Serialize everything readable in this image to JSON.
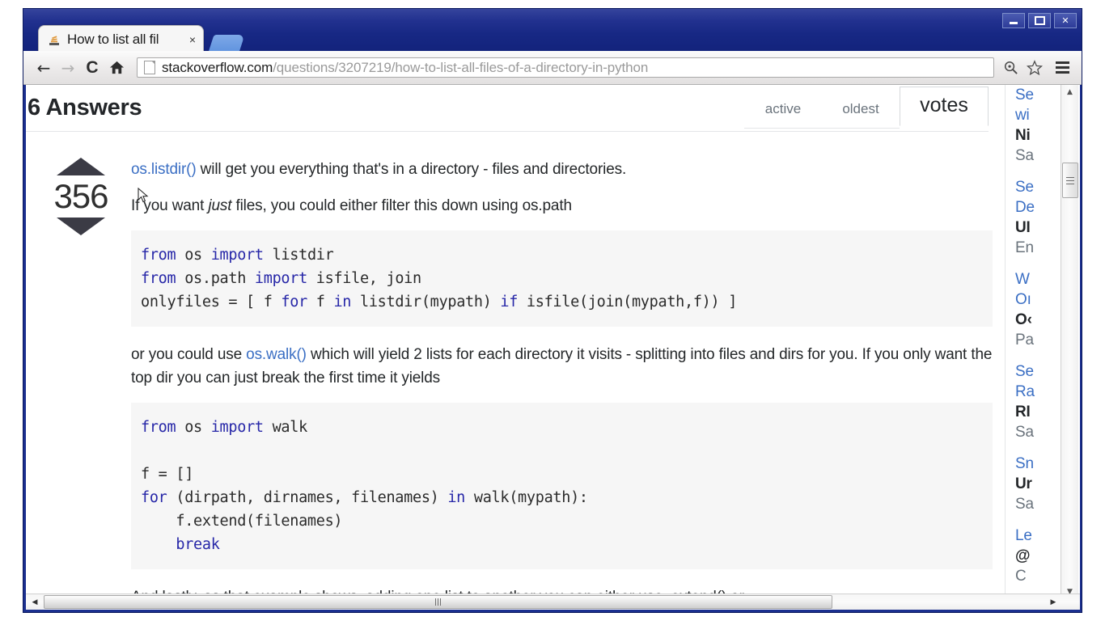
{
  "window": {
    "minimize_label": "minimize",
    "maximize_label": "maximize",
    "close_label": "✕"
  },
  "browser": {
    "tab": {
      "title": "How to list all fil",
      "close_label": "×",
      "favicon_name": "stackoverflow-favicon"
    },
    "toolbar": {
      "back_label": "←",
      "forward_label": "→",
      "reload_label": "C",
      "home_label": "⌂",
      "url_host": "stackoverflow.com",
      "url_path": "/questions/3207219/how-to-list-all-files-of-a-directory-in-python",
      "url_full": "stackoverflow.com/questions/3207219/how-to-list-all-files-of-a-directory-in-python",
      "zoom_search_label": "⚲",
      "bookmark_label": "☆"
    }
  },
  "page": {
    "answers_heading": "6 Answers",
    "sort_tabs": [
      {
        "label": "active",
        "selected": false
      },
      {
        "label": "oldest",
        "selected": false
      },
      {
        "label": "votes",
        "selected": true
      }
    ],
    "answer": {
      "votes": "356",
      "upvote_label": "up vote",
      "downvote_label": "down vote",
      "paragraph_1_link": "os.listdir()",
      "paragraph_1_rest": " will get you everything that's in a directory - files and directories.",
      "paragraph_2_a": "If you want ",
      "paragraph_2_em": "just",
      "paragraph_2_b": " files, you could either filter this down using os.path",
      "code_1": "from os import listdir\nfrom os.path import isfile, join\nonlyfiles = [ f for f in listdir(mypath) if isfile(join(mypath,f)) ]",
      "code_1_lines": [
        {
          "kw": "from",
          "t1": " os ",
          "kw2": "import",
          "t2": " listdir"
        },
        {
          "kw": "from",
          "t1": " os.path ",
          "kw2": "import",
          "t2": " isfile, join"
        }
      ],
      "paragraph_3_a": "or you could use ",
      "paragraph_3_link": "os.walk()",
      "paragraph_3_b": " which will yield 2 lists for each directory it visits - splitting into files and dirs for you. If you only want the top dir you can just break the first time it yields",
      "code_2": "from os import walk\n\nf = []\nfor (dirpath, dirnames, filenames) in walk(mypath):\n    f.extend(filenames)\n    break",
      "paragraph_4": "And lastly, as that example shows, adding one list to another you can either use .extend() or"
    },
    "sidebar_lines": [
      {
        "text": "Se",
        "style": "link"
      },
      {
        "text": "wi",
        "style": "link"
      },
      {
        "text": "Ni",
        "style": "bold"
      },
      {
        "text": "Sa",
        "style": "muted"
      },
      {
        "text": "",
        "style": "gap"
      },
      {
        "text": "Se",
        "style": "link"
      },
      {
        "text": "De",
        "style": "link"
      },
      {
        "text": "UI",
        "style": "bold"
      },
      {
        "text": "En",
        "style": "muted"
      },
      {
        "text": "",
        "style": "gap"
      },
      {
        "text": "W",
        "style": "link"
      },
      {
        "text": "Oı",
        "style": "link"
      },
      {
        "text": "O‹",
        "style": "bold"
      },
      {
        "text": "Pa",
        "style": "muted"
      },
      {
        "text": "",
        "style": "gap"
      },
      {
        "text": "Se",
        "style": "link"
      },
      {
        "text": "Ra",
        "style": "link"
      },
      {
        "text": "RI",
        "style": "bold"
      },
      {
        "text": "Sa",
        "style": "muted"
      },
      {
        "text": "",
        "style": "gap"
      },
      {
        "text": "Sn",
        "style": "link"
      },
      {
        "text": "Ur",
        "style": "bold"
      },
      {
        "text": "Sa",
        "style": "muted"
      },
      {
        "text": "",
        "style": "gap"
      },
      {
        "text": "Le",
        "style": "link"
      },
      {
        "text": "@",
        "style": "bold"
      },
      {
        "text": "C",
        "style": "muted"
      }
    ]
  },
  "scrollbars": {
    "v_up": "▲",
    "v_down": "▼",
    "h_left": "◀",
    "h_right": "▶"
  },
  "colors": {
    "link": "#3b6fc4",
    "code_keyword": "#2727a8",
    "code_bg": "#f6f6f6",
    "chrome_blue": "#1b2f8f",
    "text": "#242729"
  }
}
